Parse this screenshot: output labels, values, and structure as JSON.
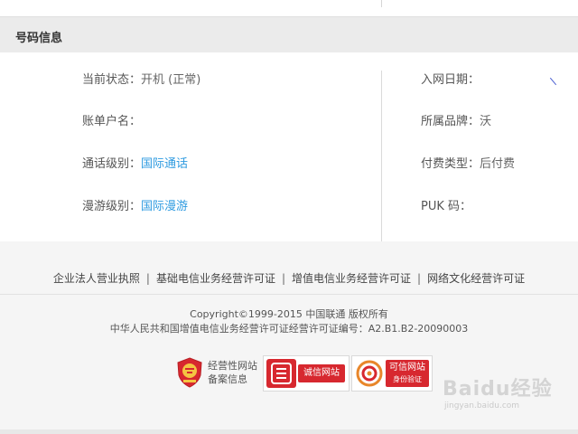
{
  "section": {
    "title": "号码信息"
  },
  "fields_left": [
    {
      "label": "当前状态：",
      "value": "开机 (正常)",
      "link": false
    },
    {
      "label": "账单户名：",
      "value": "",
      "link": false
    },
    {
      "label": "通话级别：",
      "value": "国际通话",
      "link": true
    },
    {
      "label": "漫游级别：",
      "value": "国际漫游",
      "link": true
    }
  ],
  "fields_right": [
    {
      "label": "入网日期：",
      "value": "",
      "link": false
    },
    {
      "label": "所属品牌：",
      "value": "沃",
      "link": false
    },
    {
      "label": "付费类型：",
      "value": "后付费",
      "link": false
    },
    {
      "label": "PUK  码：",
      "value": "",
      "link": false
    }
  ],
  "footer": {
    "links": [
      "企业法人营业执照",
      "基础电信业务经营许可证",
      "增值电信业务经营许可证",
      "网络文化经营许可证"
    ],
    "separator": "|",
    "copyright": "Copyright©1999-2015  中国联通 版权所有",
    "license": "中华人民共和国增值电信业务经营许可证经营许可证编号：A2.B1.B2-20090003",
    "badge_emblem_line1": "经营性网站",
    "badge_emblem_line2": "备案信息",
    "badge_credit_label": "诚信网站",
    "badge_trust_label": "可信网站",
    "badge_trust_sub": "身份验证"
  },
  "watermark": {
    "text": "Baidu经验",
    "url": "jingyan.baidu.com"
  },
  "colors": {
    "link": "#2f9be0",
    "badge_red": "#d7282f",
    "header_bg": "#ebebeb",
    "footer_bg": "#f5f5f5"
  }
}
